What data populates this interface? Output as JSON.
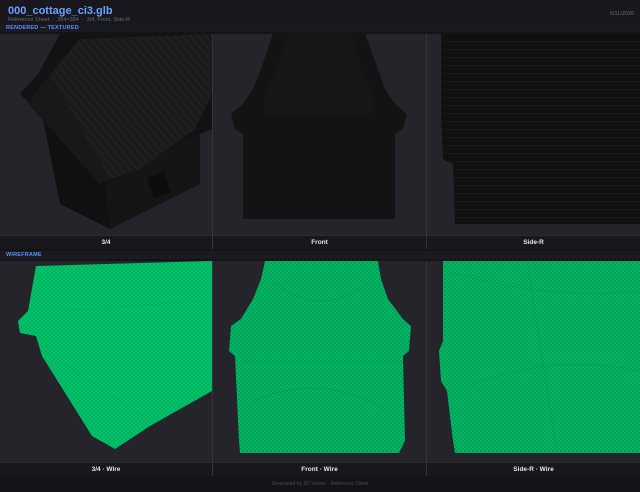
{
  "header": {
    "title": "000_cottage_ci3.glb",
    "subtitle": "Reference Sheet  ·  384×384  ·  3/4, Front, Side-R",
    "date": "6/11/2026"
  },
  "sections": {
    "rendered_label": "RENDERED — TEXTURED",
    "wireframe_label": "WIREFRAME"
  },
  "rendered_views": [
    {
      "caption": "3/4"
    },
    {
      "caption": "Front"
    },
    {
      "caption": "Side-R"
    }
  ],
  "wireframe_views": [
    {
      "caption": "3/4 · Wire"
    },
    {
      "caption": "Front · Wire"
    },
    {
      "caption": "Side-R · Wire"
    }
  ],
  "footer": {
    "text": "Generated by 3D Viewer · Reference Sheet"
  },
  "colors": {
    "background": "#131318",
    "panel": "#24242a",
    "accent": "#5b8cff",
    "wireframe": "#00c26a",
    "model": "#141414"
  }
}
